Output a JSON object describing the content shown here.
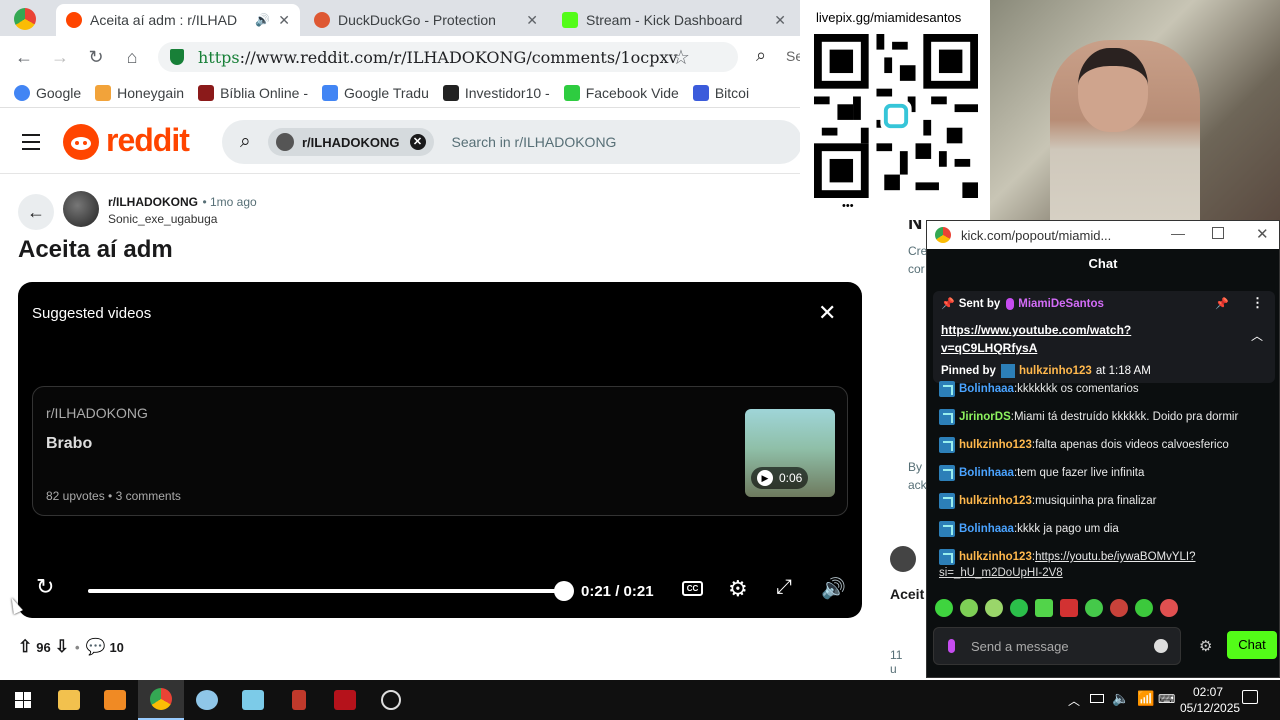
{
  "browser": {
    "tabs": [
      {
        "title": "Aceita aí adm : r/ILHAD",
        "active": true
      },
      {
        "title": "DuckDuckGo - Protection",
        "active": false
      },
      {
        "title": "Stream - Kick Dashboard",
        "active": false
      }
    ],
    "url_scheme": "https",
    "url_rest": "://www.reddit.com/r/ILHADOKONG/comments/1ocpxv",
    "search_partial": "Se",
    "bookmarks": [
      "Google",
      "Honeygain",
      "Bíblia Online -",
      "Google Tradu",
      "Investidor10 -",
      "Facebook Vide",
      "Bitcoi"
    ]
  },
  "reddit": {
    "logo_text": "reddit",
    "search_chip": "r/ILHADOKONG",
    "search_placeholder": "Search in r/ILHADOKONG",
    "post": {
      "subreddit": "r/ILHADOKONG",
      "time": "1mo ago",
      "author": "Sonic_exe_ugabuga",
      "title": "Aceita aí adm",
      "upvotes": "96",
      "comments": "10"
    },
    "player": {
      "heading": "Suggested videos",
      "card_sub": "r/ILHADOKONG",
      "card_title": "Brabo",
      "card_stats": "82 upvotes • 3 comments",
      "thumb_duration": "0:06",
      "time": "0:21 / 0:21",
      "progress": 1.0
    },
    "right_col": {
      "heading_partial": "N",
      "line1": "Cre",
      "line2": "cor",
      "by": "By",
      "ack": "ack",
      "aceit": "Aceit",
      "count": "11 u"
    }
  },
  "overlay": {
    "qr_label": "livepix.gg/miamidesantos",
    "dots": "•••"
  },
  "chat": {
    "window_title": "kick.com/popout/miamid...",
    "header": "Chat",
    "pinned": {
      "sent_by_label": "Sent by",
      "sender": "MiamiDeSantos",
      "link": "https://www.youtube.com/watch?v=qC9LHQRfysA",
      "link_line1": "https://www.youtube.com/watch?",
      "link_line2": "v=qC9LHQRfysA",
      "pinned_by_label": "Pinned by",
      "pinner": "hulkzinho123",
      "at": "at 1:18 AM"
    },
    "messages": [
      {
        "user": "Bolinhaaa",
        "color": "#4aa3ff",
        "text": "kkkkkkk os comentarios"
      },
      {
        "user": "JirinorDS",
        "color": "#8df25f",
        "text": "Miami tá destruído kkkkkk. Doido pra dormir"
      },
      {
        "user": "hulkzinho123",
        "color": "#ffb84d",
        "text": "falta apenas dois videos calvoesferico"
      },
      {
        "user": "Bolinhaaa",
        "color": "#4aa3ff",
        "text": "tem que fazer live infinita"
      },
      {
        "user": "hulkzinho123",
        "color": "#ffb84d",
        "text": "musiquinha pra finalizar"
      },
      {
        "user": "Bolinhaaa",
        "color": "#4aa3ff",
        "text": "kkkk ja pago um dia"
      },
      {
        "user": "hulkzinho123",
        "color": "#ffb84d",
        "text": "https://youtu.be/iywaBOMvYLI?"
      }
    ],
    "last_link_cont": "si=_hU_m2DoUpHI-2V8",
    "input_placeholder": "Send a message",
    "send_label": "Chat"
  },
  "taskbar": {
    "time": "02:07",
    "date": "05/12/2025"
  }
}
